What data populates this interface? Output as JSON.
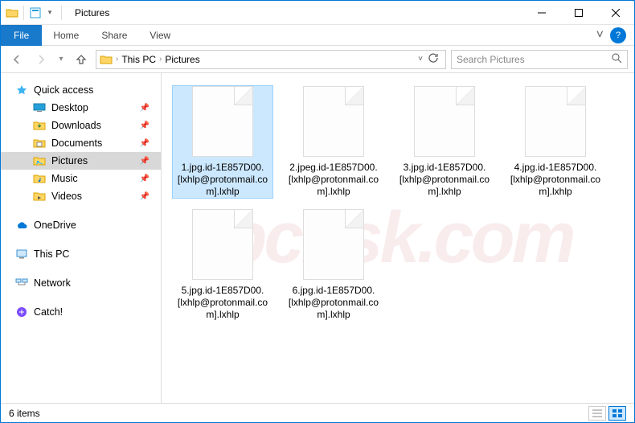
{
  "titlebar": {
    "title": "Pictures"
  },
  "window": {
    "min": "–",
    "max": "☐",
    "close": "✕"
  },
  "ribbon": {
    "file": "File",
    "tabs": [
      "Home",
      "Share",
      "View"
    ]
  },
  "address": {
    "crumbs": [
      "This PC",
      "Pictures"
    ],
    "search_placeholder": "Search Pictures"
  },
  "sidebar": {
    "quick": "Quick access",
    "quick_items": [
      {
        "label": "Desktop",
        "icon": "desktop"
      },
      {
        "label": "Downloads",
        "icon": "downloads"
      },
      {
        "label": "Documents",
        "icon": "documents"
      },
      {
        "label": "Pictures",
        "icon": "pictures",
        "selected": true
      },
      {
        "label": "Music",
        "icon": "music"
      },
      {
        "label": "Videos",
        "icon": "videos"
      }
    ],
    "roots": [
      {
        "label": "OneDrive",
        "icon": "onedrive"
      },
      {
        "label": "This PC",
        "icon": "thispc"
      },
      {
        "label": "Network",
        "icon": "network"
      },
      {
        "label": "Catch!",
        "icon": "catch"
      }
    ]
  },
  "files": [
    {
      "name": "1.jpg.id-1E857D00.[lxhlp@protonmail.com].lxhlp",
      "selected": true
    },
    {
      "name": "2.jpeg.id-1E857D00.[lxhlp@protonmail.com].lxhlp"
    },
    {
      "name": "3.jpg.id-1E857D00.[lxhlp@protonmail.com].lxhlp"
    },
    {
      "name": "4.jpg.id-1E857D00.[lxhlp@protonmail.com].lxhlp"
    },
    {
      "name": "5.jpg.id-1E857D00.[lxhlp@protonmail.com].lxhlp"
    },
    {
      "name": "6.jpg.id-1E857D00.[lxhlp@protonmail.com].lxhlp"
    }
  ],
  "status": {
    "count": "6 items"
  },
  "watermark": "pcrisk.com"
}
